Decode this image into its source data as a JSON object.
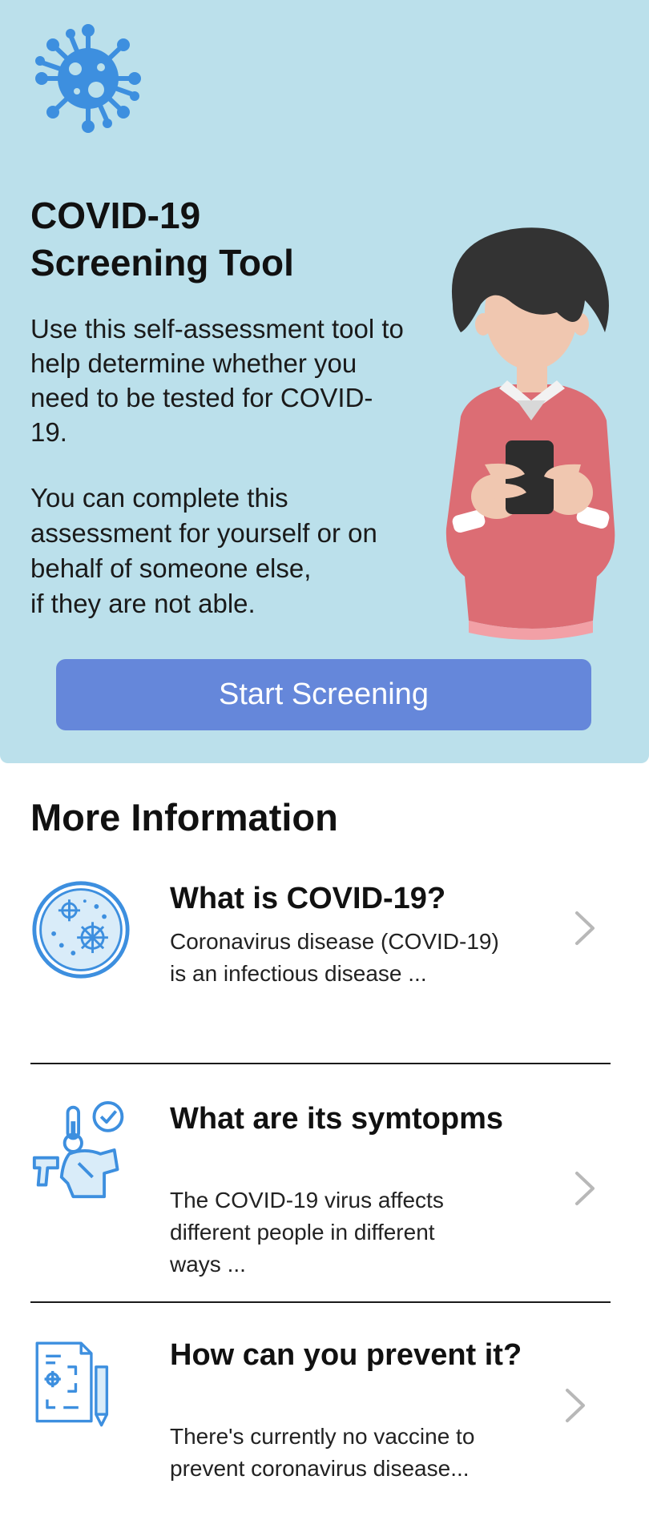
{
  "hero": {
    "title": "COVID-19\nScreening Tool",
    "description": "Use this self-assessment tool to\nhelp determine whether you\nneed to be tested for COVID-\n19.",
    "description2": "You can complete this\nassessment for yourself or on\nbehalf of someone else,\nif they are not able.",
    "start_button": "Start Screening",
    "colors": {
      "background": "#bbe0eb",
      "button": "#6587da",
      "virus": "#3d8fdf"
    }
  },
  "more_info": {
    "title": "More Information",
    "items": [
      {
        "heading": "What is COVID-19?",
        "body": "Coronavirus disease (COVID-19)\nis an infectious disease ...",
        "icon": "petri-dish-virus-icon"
      },
      {
        "heading": "What are its symtopms",
        "body": "The COVID-19 virus affects\ndifferent people in different\nways ...",
        "icon": "thermometer-symptoms-icon"
      },
      {
        "heading": "How can you prevent it?",
        "body": "There's currently no vaccine to\n prevent coronavirus disease...",
        "icon": "prevention-plan-icon"
      }
    ]
  }
}
